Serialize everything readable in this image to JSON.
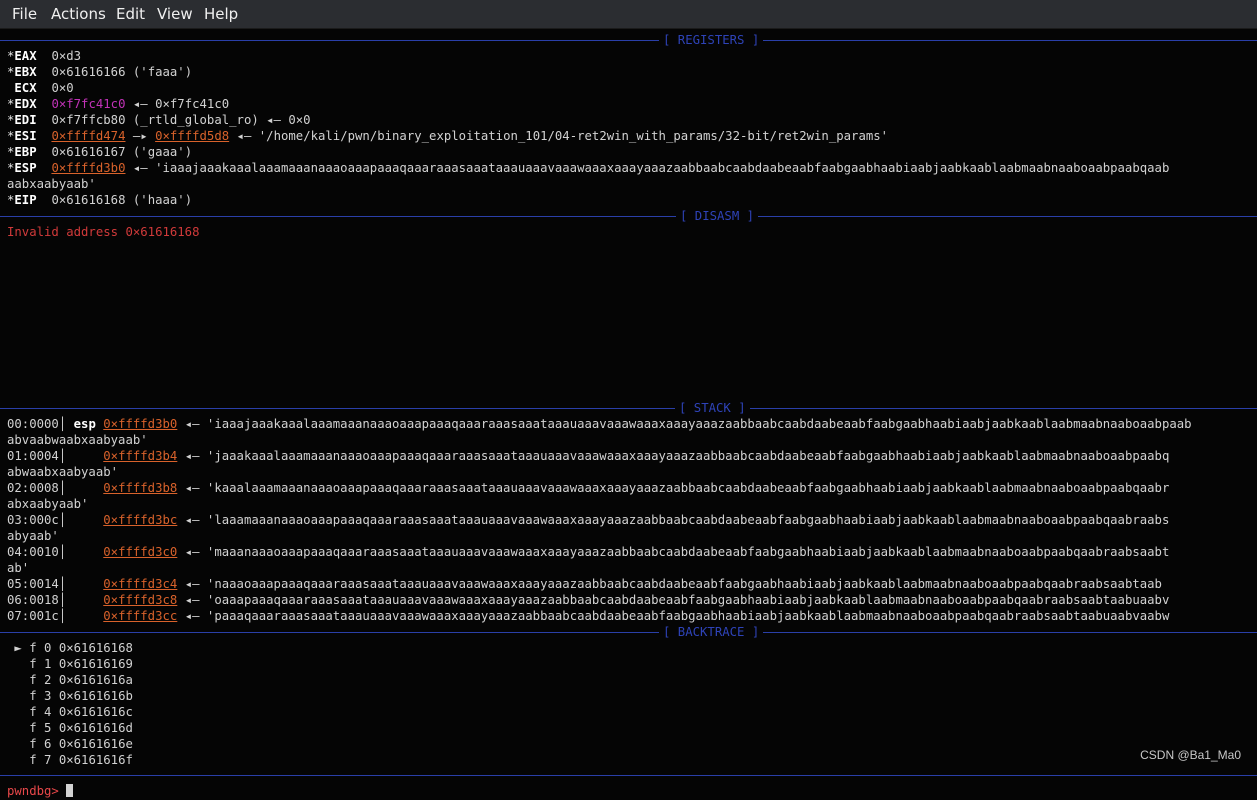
{
  "menu": {
    "items": [
      "File",
      "Actions",
      "Edit",
      "View",
      "Help"
    ]
  },
  "sections": {
    "registers": "[ REGISTERS ]",
    "disasm": "[ DISASM ]",
    "stack": "[ STACK ]",
    "backtrace": "[ BACKTRACE ]"
  },
  "registers": [
    {
      "star": "*",
      "name": "EAX",
      "value": "0×d3",
      "rest": ""
    },
    {
      "star": "*",
      "name": "EBX",
      "value": "0×61616166",
      "rest": " ('faaa')"
    },
    {
      "star": " ",
      "name": "ECX",
      "value": "0×0",
      "rest": ""
    },
    {
      "star": "*",
      "name": "EDX",
      "value": "0×f7fc41c0",
      "rest": " ◂— 0×f7fc41c0"
    },
    {
      "star": "*",
      "name": "EDI",
      "value": "0×f7ffcb80",
      "rest": " (_rtld_global_ro) ◂— 0×0"
    },
    {
      "star": "*",
      "name": "ESI",
      "value": "0×ffffd474",
      "rest2addr": "0×ffffd5d8",
      "rest": " ◂— '/home/kali/pwn/binary_exploitation_101/04-ret2win_with_params/32-bit/ret2win_params'"
    },
    {
      "star": "*",
      "name": "EBP",
      "value": "0×61616167",
      "rest": " ('gaaa')"
    },
    {
      "star": "*",
      "name": "ESP",
      "value": "0×ffffd3b0",
      "rest": " ◂— 'iaaajaaakaaalaaamaaanaaaoaaapaaaqaaaraaasaaataaauaaavaaawaaaxaaayaaazaabbaabcaabdaabeaabfaabgaabhaabiaabjaabkaablaabmaabnaaboaabpaabqaab",
      "cont": "aabxaabyaab'"
    },
    {
      "star": "*",
      "name": "EIP",
      "value": "0×61616168",
      "rest": " ('haaa')"
    }
  ],
  "disasm": {
    "error": "Invalid address 0×61616168"
  },
  "stack": [
    {
      "index": "00:0000",
      "tag": "esp",
      "addr": "0×ffffd3b0",
      "text": " ◂— 'iaaajaaakaaalaaamaaanaaaoaaapaaaqaaaraaasaaataaauaaavaaawaaaxaaayaaazaabbaabcaabdaabeaabfaabgaabhaabiaabjaabkaablaabmaabnaaboaabpaab",
      "cont": "abvaabwaabxaabyaab'"
    },
    {
      "index": "01:0004",
      "tag": "",
      "addr": "0×ffffd3b4",
      "text": " ◂— 'jaaakaaalaaamaaanaaaoaaapaaaqaaaraaasaaataaauaaavaaawaaaxaaayaaazaabbaabcaabdaabeaabfaabgaabhaabiaabjaabkaablaabmaabnaaboaabpaabq",
      "cont": "abwaabxaabyaab'"
    },
    {
      "index": "02:0008",
      "tag": "",
      "addr": "0×ffffd3b8",
      "text": " ◂— 'kaaalaaamaaanaaaoaaapaaaqaaaraaasaaataaauaaavaaawaaaxaaayaaazaabbaabcaabdaabeaabfaabgaabhaabiaabjaabkaablaabmaabnaaboaabpaabqaabr",
      "cont": "abxaabyaab'"
    },
    {
      "index": "03:000c",
      "tag": "",
      "addr": "0×ffffd3bc",
      "text": " ◂— 'laaamaaanaaaoaaapaaaqaaaraaasaaataaauaaavaaawaaaxaaayaaazaabbaabcaabdaabeaabfaabgaabhaabiaabjaabkaablaabmaabnaaboaabpaabqaabraabs",
      "cont": "abyaab'"
    },
    {
      "index": "04:0010",
      "tag": "",
      "addr": "0×ffffd3c0",
      "text": " ◂— 'maaanaaaoaaapaaaqaaaraaasaaataaauaaavaaawaaaxaaayaaazaabbaabcaabdaabeaabfaabgaabhaabiaabjaabkaablaabmaabnaaboaabpaabqaabraabsaabt",
      "cont": "ab'"
    },
    {
      "index": "05:0014",
      "tag": "",
      "addr": "0×ffffd3c4",
      "text": " ◂— 'naaaoaaapaaaqaaaraaasaaataaauaaavaaawaaaxaaayaaazaabbaabcaabdaabeaabfaabgaabhaabiaabjaabkaablaabmaabnaaboaabpaabqaabraabsaabtaab",
      "cont": ""
    },
    {
      "index": "06:0018",
      "tag": "",
      "addr": "0×ffffd3c8",
      "text": " ◂— 'oaaapaaaqaaaraaasaaataaauaaavaaawaaaxaaayaaazaabbaabcaabdaabeaabfaabgaabhaabiaabjaabkaablaabmaabnaaboaabpaabqaabraabsaabtaabuaabv",
      "cont": ""
    },
    {
      "index": "07:001c",
      "tag": "",
      "addr": "0×ffffd3cc",
      "text": " ◂— 'paaaqaaaraaasaaataaauaaavaaawaaaxaaayaaazaabbaabcaabdaabeaabfaabgaabhaabiaabjaabkaablaabmaabnaaboaabpaabqaabraabsaabtaabuaabvaabw",
      "cont": ""
    }
  ],
  "backtrace": [
    {
      "marker": "►",
      "frame": "f 0",
      "addr": "0×61616168"
    },
    {
      "marker": " ",
      "frame": "f 1",
      "addr": "0×61616169"
    },
    {
      "marker": " ",
      "frame": "f 2",
      "addr": "0×6161616a"
    },
    {
      "marker": " ",
      "frame": "f 3",
      "addr": "0×6161616b"
    },
    {
      "marker": " ",
      "frame": "f 4",
      "addr": "0×6161616c"
    },
    {
      "marker": " ",
      "frame": "f 5",
      "addr": "0×6161616d"
    },
    {
      "marker": " ",
      "frame": "f 6",
      "addr": "0×6161616e"
    },
    {
      "marker": " ",
      "frame": "f 7",
      "addr": "0×6161616f"
    }
  ],
  "prompt": "pwndbg>",
  "watermark": "CSDN @Ba1_Ma0",
  "colors": {
    "background": "#050505",
    "section_blue": "#2e43b8",
    "stack_addr": "#d9622b",
    "heap_addr": "#c233b8",
    "error_red": "#d13a3a",
    "prompt_red": "#e8484a"
  }
}
